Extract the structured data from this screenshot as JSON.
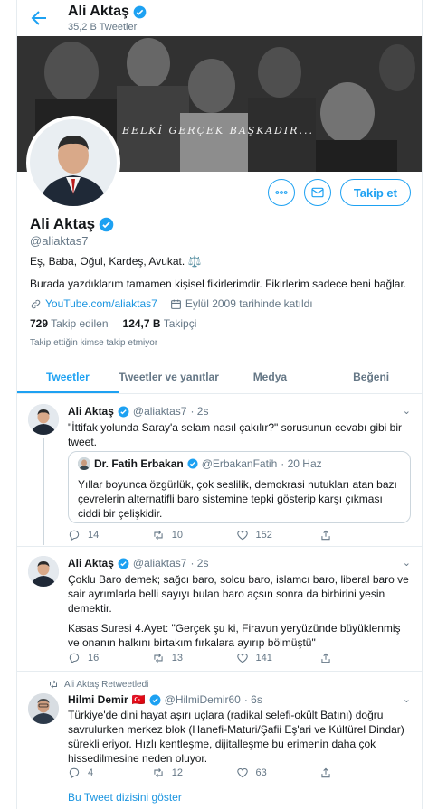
{
  "header": {
    "name": "Ali Aktaş",
    "tweet_count": "35,2 B Tweetler"
  },
  "banner": {
    "caption": "BELKİ GERÇEK BAŞKADIR..."
  },
  "profile": {
    "name": "Ali Aktaş",
    "handle": "@aliaktas7",
    "bio_line1": "Eş, Baba, Oğul, Kardeş, Avukat. ⚖️",
    "bio_line2": "Burada yazdıklarım tamamen kişisel fikirlerimdir. Fikirlerim sadece beni bağlar.",
    "website": "YouTube.com/aliaktas7",
    "joined": "Eylül 2009 tarihinde katıldı",
    "following_count": "729",
    "following_label": "Takip edilen",
    "followers_count": "124,7 B",
    "followers_label": "Takipçi",
    "followed_by_note": "Takip ettiğin kimse takip etmiyor",
    "follow_button": "Takip et"
  },
  "tabs": [
    {
      "label": "Tweetler"
    },
    {
      "label": "Tweetler ve yanıtlar"
    },
    {
      "label": "Medya"
    },
    {
      "label": "Beğeni"
    }
  ],
  "tweets": [
    {
      "name": "Ali Aktaş",
      "handle": "@aliaktas7",
      "time": "· 2s",
      "text": "\"İttifak yolunda Saray'a selam nasıl çakılır?\" sorusunun cevabı gibi bir tweet.",
      "quote": {
        "name": "Dr. Fatih Erbakan",
        "handle": "@ErbakanFatih",
        "time": "· 20 Haz",
        "text": "Yıllar boyunca özgürlük, çok seslilik, demokrasi nutukları atan bazı çevrelerin alternatifli baro sistemine tepki gösterip karşı çıkması ciddi bir çelişkidir."
      },
      "replies": "14",
      "retweets": "10",
      "likes": "152"
    },
    {
      "name": "Ali Aktaş",
      "handle": "@aliaktas7",
      "time": "· 2s",
      "text_p1": "Çoklu Baro demek; sağcı baro, solcu baro, islamcı baro, liberal baro ve sair ayrımlarla belli sayıyı bulan baro açsın sonra da birbirini yesin demektir.",
      "text_p2": "Kasas Suresi 4.Ayet: \"Gerçek şu ki, Firavun yeryüzünde büyüklenmiş ve onanın halkını birtakım fırkalara ayırıp bölmüştü\"",
      "replies": "16",
      "retweets": "13",
      "likes": "141"
    },
    {
      "retweet_label": "Ali Aktaş Retweetledi",
      "name": "Hilmi Demir",
      "flag": "🇹🇷",
      "handle": "@HilmiDemir60",
      "time": "· 6s",
      "text": "Türkiye'de dini hayat aşırı uçlara (radikal selefi-okült Batını) doğru savrulurken merkez blok (Hanefi-Maturi/Şafii Eş'ari ve Kültürel Dindar) sürekli eriyor. Hızlı kentleşme, dijitalleşme bu erimenin daha çok hissedilmesine neden oluyor.",
      "replies": "4",
      "retweets": "12",
      "likes": "63",
      "show_thread": "Bu Tweet dizisini göster"
    }
  ]
}
